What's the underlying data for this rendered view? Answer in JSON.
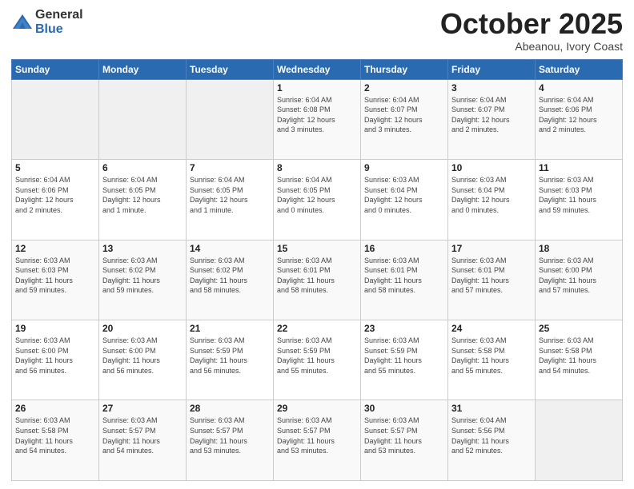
{
  "logo": {
    "general": "General",
    "blue": "Blue"
  },
  "header": {
    "month": "October 2025",
    "location": "Abeanou, Ivory Coast"
  },
  "weekdays": [
    "Sunday",
    "Monday",
    "Tuesday",
    "Wednesday",
    "Thursday",
    "Friday",
    "Saturday"
  ],
  "weeks": [
    [
      {
        "day": "",
        "info": ""
      },
      {
        "day": "",
        "info": ""
      },
      {
        "day": "",
        "info": ""
      },
      {
        "day": "1",
        "info": "Sunrise: 6:04 AM\nSunset: 6:08 PM\nDaylight: 12 hours\nand 3 minutes."
      },
      {
        "day": "2",
        "info": "Sunrise: 6:04 AM\nSunset: 6:07 PM\nDaylight: 12 hours\nand 3 minutes."
      },
      {
        "day": "3",
        "info": "Sunrise: 6:04 AM\nSunset: 6:07 PM\nDaylight: 12 hours\nand 2 minutes."
      },
      {
        "day": "4",
        "info": "Sunrise: 6:04 AM\nSunset: 6:06 PM\nDaylight: 12 hours\nand 2 minutes."
      }
    ],
    [
      {
        "day": "5",
        "info": "Sunrise: 6:04 AM\nSunset: 6:06 PM\nDaylight: 12 hours\nand 2 minutes."
      },
      {
        "day": "6",
        "info": "Sunrise: 6:04 AM\nSunset: 6:05 PM\nDaylight: 12 hours\nand 1 minute."
      },
      {
        "day": "7",
        "info": "Sunrise: 6:04 AM\nSunset: 6:05 PM\nDaylight: 12 hours\nand 1 minute."
      },
      {
        "day": "8",
        "info": "Sunrise: 6:04 AM\nSunset: 6:05 PM\nDaylight: 12 hours\nand 0 minutes."
      },
      {
        "day": "9",
        "info": "Sunrise: 6:03 AM\nSunset: 6:04 PM\nDaylight: 12 hours\nand 0 minutes."
      },
      {
        "day": "10",
        "info": "Sunrise: 6:03 AM\nSunset: 6:04 PM\nDaylight: 12 hours\nand 0 minutes."
      },
      {
        "day": "11",
        "info": "Sunrise: 6:03 AM\nSunset: 6:03 PM\nDaylight: 11 hours\nand 59 minutes."
      }
    ],
    [
      {
        "day": "12",
        "info": "Sunrise: 6:03 AM\nSunset: 6:03 PM\nDaylight: 11 hours\nand 59 minutes."
      },
      {
        "day": "13",
        "info": "Sunrise: 6:03 AM\nSunset: 6:02 PM\nDaylight: 11 hours\nand 59 minutes."
      },
      {
        "day": "14",
        "info": "Sunrise: 6:03 AM\nSunset: 6:02 PM\nDaylight: 11 hours\nand 58 minutes."
      },
      {
        "day": "15",
        "info": "Sunrise: 6:03 AM\nSunset: 6:01 PM\nDaylight: 11 hours\nand 58 minutes."
      },
      {
        "day": "16",
        "info": "Sunrise: 6:03 AM\nSunset: 6:01 PM\nDaylight: 11 hours\nand 58 minutes."
      },
      {
        "day": "17",
        "info": "Sunrise: 6:03 AM\nSunset: 6:01 PM\nDaylight: 11 hours\nand 57 minutes."
      },
      {
        "day": "18",
        "info": "Sunrise: 6:03 AM\nSunset: 6:00 PM\nDaylight: 11 hours\nand 57 minutes."
      }
    ],
    [
      {
        "day": "19",
        "info": "Sunrise: 6:03 AM\nSunset: 6:00 PM\nDaylight: 11 hours\nand 56 minutes."
      },
      {
        "day": "20",
        "info": "Sunrise: 6:03 AM\nSunset: 6:00 PM\nDaylight: 11 hours\nand 56 minutes."
      },
      {
        "day": "21",
        "info": "Sunrise: 6:03 AM\nSunset: 5:59 PM\nDaylight: 11 hours\nand 56 minutes."
      },
      {
        "day": "22",
        "info": "Sunrise: 6:03 AM\nSunset: 5:59 PM\nDaylight: 11 hours\nand 55 minutes."
      },
      {
        "day": "23",
        "info": "Sunrise: 6:03 AM\nSunset: 5:59 PM\nDaylight: 11 hours\nand 55 minutes."
      },
      {
        "day": "24",
        "info": "Sunrise: 6:03 AM\nSunset: 5:58 PM\nDaylight: 11 hours\nand 55 minutes."
      },
      {
        "day": "25",
        "info": "Sunrise: 6:03 AM\nSunset: 5:58 PM\nDaylight: 11 hours\nand 54 minutes."
      }
    ],
    [
      {
        "day": "26",
        "info": "Sunrise: 6:03 AM\nSunset: 5:58 PM\nDaylight: 11 hours\nand 54 minutes."
      },
      {
        "day": "27",
        "info": "Sunrise: 6:03 AM\nSunset: 5:57 PM\nDaylight: 11 hours\nand 54 minutes."
      },
      {
        "day": "28",
        "info": "Sunrise: 6:03 AM\nSunset: 5:57 PM\nDaylight: 11 hours\nand 53 minutes."
      },
      {
        "day": "29",
        "info": "Sunrise: 6:03 AM\nSunset: 5:57 PM\nDaylight: 11 hours\nand 53 minutes."
      },
      {
        "day": "30",
        "info": "Sunrise: 6:03 AM\nSunset: 5:57 PM\nDaylight: 11 hours\nand 53 minutes."
      },
      {
        "day": "31",
        "info": "Sunrise: 6:04 AM\nSunset: 5:56 PM\nDaylight: 11 hours\nand 52 minutes."
      },
      {
        "day": "",
        "info": ""
      }
    ]
  ]
}
